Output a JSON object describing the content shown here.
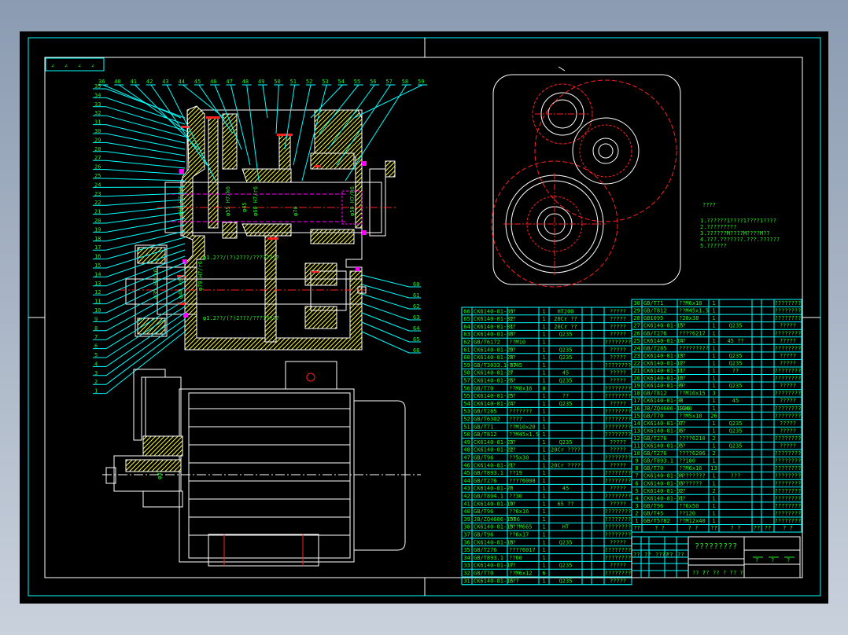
{
  "colors": {
    "frame": "#00ffff",
    "border": "#ffffff",
    "text": "#22ee22",
    "outline": "#ffffff",
    "hatch": "#ffff33",
    "center": "#ff2020",
    "hidden": "#ff00ff"
  },
  "corner_marks": [
    "∠",
    "∠",
    "∠",
    "∠"
  ],
  "notes": {
    "title": "????",
    "lines": [
      "1.??????1????1????1????",
      "2.?????????",
      "3.??????M????M????M??",
      "4.???.???????.???.??????",
      "5.??????"
    ]
  },
  "drawing_labels": {
    "top": [
      "36",
      "40",
      "41",
      "42",
      "43",
      "44",
      "45",
      "46",
      "47",
      "48",
      "49",
      "50",
      "51",
      "52",
      "53",
      "54",
      "55",
      "56",
      "57",
      "58",
      "59"
    ],
    "left": [
      "35",
      "34",
      "33",
      "32",
      "31",
      "30",
      "29",
      "28",
      "27",
      "26",
      "25",
      "24",
      "23",
      "22",
      "21",
      "20",
      "19",
      "18",
      "17",
      "16",
      "15",
      "14",
      "13",
      "12",
      "11",
      "10",
      "9",
      "8",
      "7",
      "6",
      "5",
      "4",
      "3",
      "2",
      "1"
    ],
    "right": [
      "60",
      "61",
      "62",
      "63",
      "64",
      "65",
      "66"
    ],
    "dims": [
      "φ40 H7/k6",
      "φ55 H7/k6",
      "φ45",
      "φ60 H7/r6",
      "φ70",
      "φ50 H7/k6",
      "φ35 H7/k6",
      "φ40 k6",
      "φ70 H7/r6",
      "φ32"
    ],
    "gear_notes": [
      "φ1.2??/(?)2???/????????",
      "φ1.2??/(?)2???/????????"
    ]
  },
  "parts_left": [
    [
      "66",
      "CK6140-01-33",
      "??",
      "1",
      "HT200",
      "",
      "",
      "?????"
    ],
    [
      "65",
      "CK6140-01-32",
      "??",
      "1",
      "20Cr ??",
      "",
      "",
      "?????"
    ],
    [
      "64",
      "CK6140-01-31",
      "??",
      "1",
      "20Cr ??",
      "",
      "",
      "?????"
    ],
    [
      "63",
      "CK6140-01-30",
      "??",
      "1",
      "Q235",
      "",
      "",
      "?????"
    ],
    [
      "62",
      "GB/T6172",
      "??M10",
      "1",
      "",
      "",
      "",
      "????????"
    ],
    [
      "61",
      "CK6140-01-29",
      "??",
      "1",
      "Q235",
      "",
      "",
      "?????"
    ],
    [
      "60",
      "CK6140-01-28",
      "??",
      "1",
      "Q235",
      "",
      "",
      "?????"
    ],
    [
      "59",
      "GB/T3033.1-87",
      "??45",
      "1",
      "",
      "",
      "",
      "????????"
    ],
    [
      "58",
      "CK6140-01-27",
      "?",
      "1",
      "45",
      "",
      "",
      "?????"
    ],
    [
      "57",
      "CK6140-01-26",
      "??",
      "1",
      "Q235",
      "",
      "",
      "?????"
    ],
    [
      "56",
      "GB/T70",
      "??M8x16",
      "8",
      "",
      "",
      "",
      "????????"
    ],
    [
      "55",
      "CK6140-01-25",
      "??",
      "1",
      "??",
      "",
      "",
      "????????"
    ],
    [
      "54",
      "CK6140-01-24",
      "??",
      "1",
      "Q235",
      "",
      "",
      "?????"
    ],
    [
      "53",
      "GB/T285",
      "???????",
      "1",
      "",
      "",
      "",
      "????????"
    ],
    [
      "52",
      "GB/T6302",
      "????",
      "1",
      "",
      "",
      "",
      "????????"
    ],
    [
      "51",
      "GB/T71",
      "??M10x20",
      "1",
      "",
      "",
      "",
      "????????"
    ],
    [
      "50",
      "GB/T812",
      "??M45x1.5",
      "1",
      "",
      "",
      "",
      "????????"
    ],
    [
      "49",
      "CK6140-01-23",
      "??",
      "1",
      "Q235",
      "",
      "",
      "?????"
    ],
    [
      "48",
      "CK6140-01-22",
      "??",
      "1",
      "20Cr ????",
      "",
      "",
      "?????"
    ],
    [
      "47",
      "GB/T96",
      "??5x30",
      "1",
      "",
      "",
      "",
      "????????"
    ],
    [
      "46",
      "CK6140-01-21",
      "??",
      "1",
      "20Cr ????",
      "",
      "",
      "?????"
    ],
    [
      "45",
      "GB/T893.1",
      "??19",
      "1",
      "",
      "",
      "",
      "????????"
    ],
    [
      "44",
      "GB/T276",
      "????6008",
      "1",
      "",
      "",
      "",
      "????????"
    ],
    [
      "43",
      "CK6140-01-20",
      "?",
      "1",
      "45",
      "",
      "",
      "?????"
    ],
    [
      "42",
      "GB/T894.1",
      "??30",
      "1",
      "",
      "",
      "",
      "????????"
    ],
    [
      "41",
      "CK6140-01-19",
      "??",
      "1",
      "65 ??",
      "",
      "",
      "?????"
    ],
    [
      "40",
      "GB/T96",
      "??6x16",
      "1",
      "",
      "",
      "",
      "????????"
    ],
    [
      "39",
      "JB/ZQ4606-1986",
      "??",
      "1",
      "",
      "",
      "",
      "????????"
    ],
    [
      "38",
      "CK6140-01-19",
      "???M665",
      "1",
      "HT",
      "",
      "",
      "????????"
    ],
    [
      "37",
      "GB/T96",
      "??6x17",
      "1",
      "",
      "",
      "",
      "????????"
    ],
    [
      "36",
      "CK6140-01-18",
      "??",
      "1",
      "Q235",
      "",
      "",
      "?????"
    ],
    [
      "35",
      "GB/T276",
      "????6017",
      "1",
      "",
      "",
      "",
      "????????"
    ],
    [
      "34",
      "GB/T893.1",
      "??60",
      "1",
      "",
      "",
      "",
      "????????"
    ],
    [
      "33",
      "CK6140-01-17",
      "??",
      "1",
      "Q235",
      "",
      "",
      "?????"
    ],
    [
      "32",
      "GB/T70",
      "??M6x12",
      "6",
      "",
      "",
      "",
      "????????"
    ],
    [
      "31",
      "CK6140-01-16",
      "???",
      "1",
      "Q235",
      "",
      "",
      "?????"
    ]
  ],
  "parts_right": [
    [
      "30",
      "GB/T71",
      "??M6x18",
      "1",
      "",
      "",
      "",
      "????????"
    ],
    [
      "29",
      "GB/T812",
      "??M45x1.5",
      "1",
      "",
      "",
      "",
      "????????"
    ],
    [
      "28",
      "GB1095",
      "?20x38",
      "1",
      "",
      "",
      "",
      "????????"
    ],
    [
      "27",
      "CK6140-01-15",
      "??",
      "1",
      "Q235",
      "",
      "",
      "?????"
    ],
    [
      "26",
      "GB/T276",
      "????6217",
      "1",
      "",
      "",
      "",
      "????????"
    ],
    [
      "25",
      "CK6140-01-14",
      "??",
      "1",
      "45 ??",
      "",
      "",
      "?????"
    ],
    [
      "24",
      "GB/T285",
      "?????????",
      "1",
      "",
      "",
      "",
      "????????"
    ],
    [
      "23",
      "CK6140-01-13",
      "??",
      "1",
      "Q235",
      "",
      "",
      "?????"
    ],
    [
      "22",
      "CK6140-01-12",
      "??",
      "1",
      "Q235",
      "",
      "",
      "?????"
    ],
    [
      "21",
      "CK6140-01-11",
      "??",
      "1",
      "??",
      "",
      "",
      "????????"
    ],
    [
      "20",
      "CK6140-01-10",
      "??",
      "1",
      "",
      "",
      "",
      "????????"
    ],
    [
      "19",
      "CK6140-01-09",
      "??",
      "1",
      "Q235",
      "",
      "",
      "?????"
    ],
    [
      "18",
      "GB/T812",
      "??M10x15",
      "3",
      "",
      "",
      "",
      "????????"
    ],
    [
      "17",
      "CK6140-01-08",
      "?",
      "1",
      "45",
      "",
      "",
      "?????"
    ],
    [
      "16",
      "JB/ZQ4606-1986",
      "1140",
      "1",
      "",
      "",
      "",
      "????????"
    ],
    [
      "15",
      "GB/T70",
      "??M5x18",
      "26",
      "",
      "",
      "",
      "????????"
    ],
    [
      "14",
      "CK6140-01-07",
      "??",
      "1",
      "Q235",
      "",
      "",
      "?????"
    ],
    [
      "13",
      "CK6140-01-06",
      "??",
      "1",
      "Q235",
      "",
      "",
      "?????"
    ],
    [
      "12",
      "GB/T276",
      "????6210",
      "2",
      "",
      "",
      "",
      "????????"
    ],
    [
      "11",
      "CK6140-01-05",
      "??",
      "1",
      "Q235",
      "",
      "",
      "?????"
    ],
    [
      "10",
      "GB/T276",
      "????6206",
      "2",
      "",
      "",
      "",
      "????????"
    ],
    [
      "9",
      "GB/T893.1",
      "??180",
      "1",
      "",
      "",
      "",
      "????????"
    ],
    [
      "8",
      "GB/T70",
      "??M6x16",
      "13",
      "",
      "",
      "",
      "????????"
    ],
    [
      "7",
      "CK6140-01-04",
      "????????",
      "1",
      "???",
      "",
      "",
      "????????"
    ],
    [
      "6",
      "CK6140-01-03",
      "???????",
      "1",
      "",
      "",
      "",
      "????????"
    ],
    [
      "5",
      "CK6140-01-02",
      "??",
      "2",
      "",
      "",
      "",
      "????????"
    ],
    [
      "4",
      "CK6140-01-01",
      "??",
      "1",
      "",
      "",
      "",
      "????????"
    ],
    [
      "3",
      "GB/T96",
      "??6x50",
      "1",
      "",
      "",
      "",
      "????????"
    ],
    [
      "2",
      "GB/T45",
      "??120",
      "1",
      "",
      "",
      "",
      "????????"
    ],
    [
      "1",
      "GB/T5782",
      "??M12x40",
      "1",
      "",
      "",
      "",
      "????????"
    ]
  ],
  "parts_header": [
    "??",
    "? ?",
    "? ?",
    "??",
    "? ?",
    "??",
    "??",
    "? ?"
  ],
  "title_block": {
    "title": "?????????",
    "marks": [
      "?",
      "?",
      "?"
    ],
    "cells": [
      "??",
      "??",
      "????",
      "??",
      "??",
      "?? ?",
      "??",
      "??",
      "? ?",
      "? ?"
    ]
  }
}
